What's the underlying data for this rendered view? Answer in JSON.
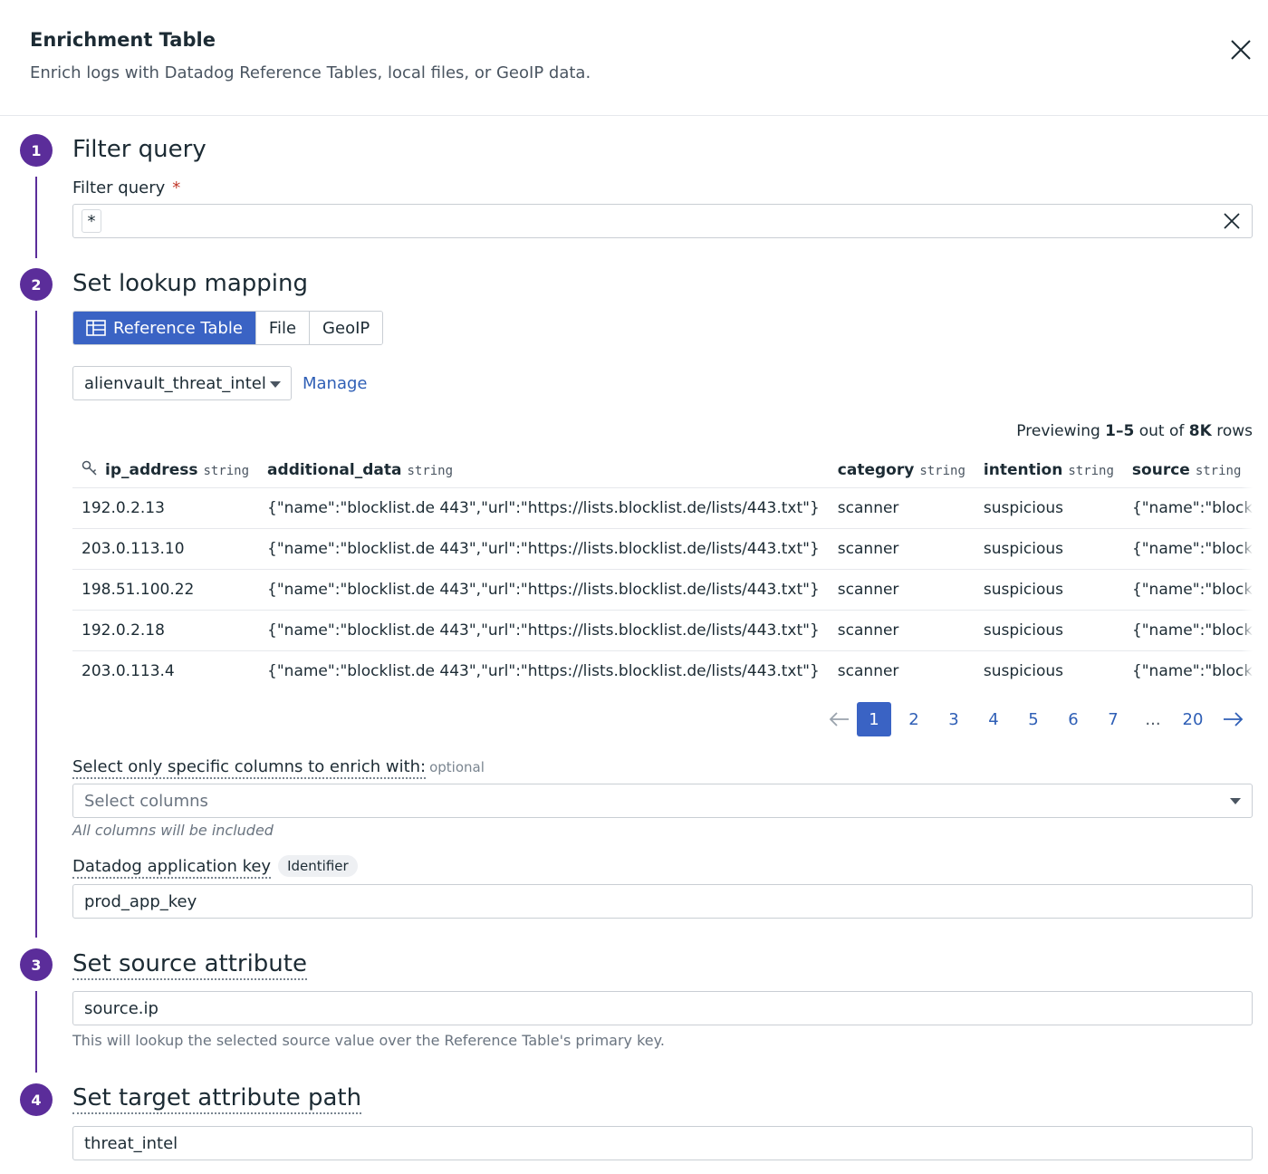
{
  "header": {
    "title": "Enrichment Table",
    "subtitle": "Enrich logs with Datadog Reference Tables, local files, or GeoIP data."
  },
  "steps": [
    {
      "number": "1",
      "title": "Filter query"
    },
    {
      "number": "2",
      "title": "Set lookup mapping"
    },
    {
      "number": "3",
      "title": "Set source attribute"
    },
    {
      "number": "4",
      "title": "Set target attribute path"
    }
  ],
  "filter": {
    "label": "Filter query",
    "required_mark": "*",
    "value": "*"
  },
  "lookup": {
    "tabs": [
      {
        "label": "Reference Table",
        "active": true
      },
      {
        "label": "File",
        "active": false
      },
      {
        "label": "GeoIP",
        "active": false
      }
    ],
    "selected_table": "alienvault_threat_intel",
    "manage_label": "Manage",
    "preview": {
      "prefix": "Previewing ",
      "range": "1–5",
      "middle": " out of ",
      "total": "8K",
      "suffix": " rows"
    },
    "columns": [
      {
        "name": "ip_address",
        "type": "string"
      },
      {
        "name": "additional_data",
        "type": "string"
      },
      {
        "name": "category",
        "type": "string"
      },
      {
        "name": "intention",
        "type": "string"
      },
      {
        "name": "source",
        "type": "string"
      }
    ],
    "rows": [
      [
        "192.0.2.13",
        "{\"name\":\"blocklist.de 443\",\"url\":\"https://lists.blocklist.de/lists/443.txt\"}",
        "scanner",
        "suspicious",
        "{\"name\":\"blocklist.de"
      ],
      [
        "203.0.113.10",
        "{\"name\":\"blocklist.de 443\",\"url\":\"https://lists.blocklist.de/lists/443.txt\"}",
        "scanner",
        "suspicious",
        "{\"name\":\"blocklist.de"
      ],
      [
        "198.51.100.22",
        "{\"name\":\"blocklist.de 443\",\"url\":\"https://lists.blocklist.de/lists/443.txt\"}",
        "scanner",
        "suspicious",
        "{\"name\":\"blocklist.de"
      ],
      [
        "192.0.2.18",
        "{\"name\":\"blocklist.de 443\",\"url\":\"https://lists.blocklist.de/lists/443.txt\"}",
        "scanner",
        "suspicious",
        "{\"name\":\"blocklist.de"
      ],
      [
        "203.0.113.4",
        "{\"name\":\"blocklist.de 443\",\"url\":\"https://lists.blocklist.de/lists/443.txt\"}",
        "scanner",
        "suspicious",
        "{\"name\":\"blocklist.de"
      ]
    ],
    "pagination": {
      "pages": [
        "1",
        "2",
        "3",
        "4",
        "5",
        "6",
        "7",
        "...",
        "20"
      ],
      "current": "1"
    },
    "columns_select": {
      "label": "Select only specific columns to enrich with:",
      "optional": "optional",
      "placeholder": "Select columns",
      "hint": "All columns will be included"
    },
    "app_key": {
      "label": "Datadog application key",
      "badge": "Identifier",
      "value": "prod_app_key"
    }
  },
  "source_attr": {
    "value": "source.ip",
    "hint": "This will lookup the selected source value over the Reference Table's primary key."
  },
  "target_attr": {
    "value": "threat_intel"
  },
  "colors": {
    "step": "#5b2d9a",
    "primary": "#3a63c4",
    "link": "#2f5fb6"
  }
}
